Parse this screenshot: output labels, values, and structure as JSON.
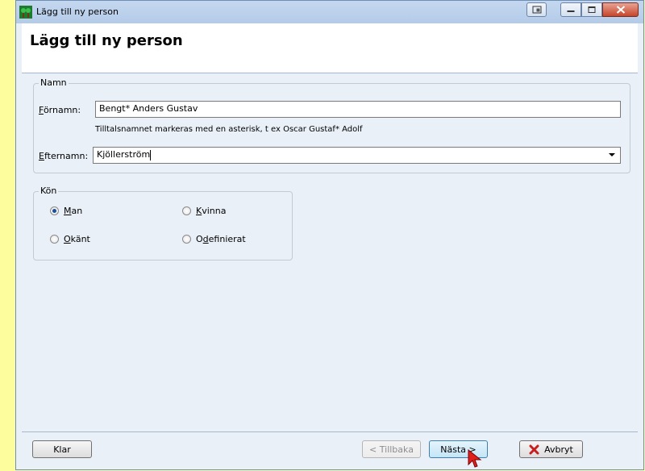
{
  "window": {
    "title": "Lägg till ny person"
  },
  "page": {
    "title": "Lägg till ny person"
  },
  "name_group": {
    "legend": "Namn",
    "first_name_label_accesskey": "F",
    "first_name_label_rest": "örnamn:",
    "first_name_value": "Bengt* Anders Gustav",
    "hint": "Tilltalsnamnet markeras med en asterisk, t ex  Oscar Gustaf* Adolf",
    "last_name_label_accesskey": "E",
    "last_name_label_rest": "fternamn:",
    "last_name_value": "Kjöllerström"
  },
  "gender_group": {
    "legend": "Kön",
    "options": [
      {
        "accesskey": "M",
        "rest": "an",
        "checked": true
      },
      {
        "accesskey": "K",
        "rest": "vinna",
        "checked": false
      },
      {
        "accesskey": "O",
        "rest": "känt",
        "checked": false
      },
      {
        "prefix": "O",
        "accesskey": "d",
        "rest": "efinierat",
        "checked": false
      }
    ]
  },
  "buttons": {
    "done": "Klar",
    "back": "< Tillbaka",
    "next": "Nästa >",
    "cancel": "Avbryt"
  },
  "colors": {
    "desktop": "#fdfd9e",
    "window_bg": "#e9f0f8",
    "cancel_icon": "#c81e1e",
    "cursor": "#e0201c"
  },
  "icons": {
    "app": "family-tree-icon",
    "restore": "restore-icon",
    "minimize": "minimize-icon",
    "maximize": "maximize-icon",
    "close": "close-icon",
    "cancel": "red-x-icon"
  }
}
